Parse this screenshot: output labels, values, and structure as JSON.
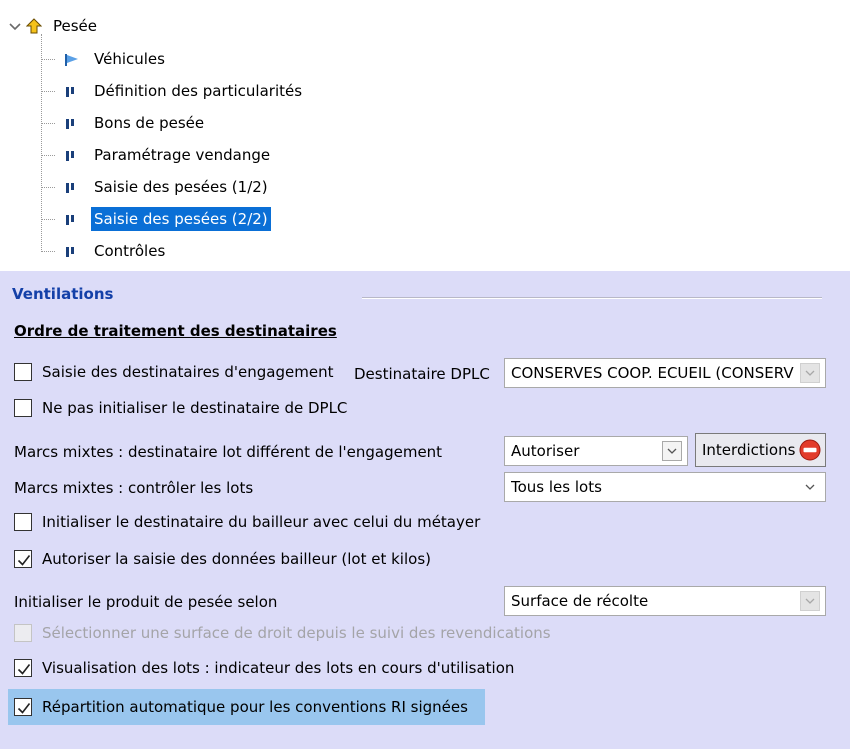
{
  "tree": {
    "root_label": "Pesée",
    "items": [
      {
        "label": "Véhicules",
        "icon": "flag-icon"
      },
      {
        "label": "Définition des particularités",
        "icon": "bar-icon"
      },
      {
        "label": "Bons de pesée",
        "icon": "bar-icon"
      },
      {
        "label": "Paramétrage vendange",
        "icon": "bar-icon"
      },
      {
        "label": "Saisie des pesées (1/2)",
        "icon": "bar-icon"
      },
      {
        "label": "Saisie des pesées (2/2)",
        "icon": "bar-icon",
        "selected": true
      },
      {
        "label": "Contrôles",
        "icon": "bar-icon"
      }
    ]
  },
  "panel": {
    "section_title": "Ventilations",
    "subsection_title": "Ordre de traitement des destinataires",
    "saisie_destinataires": {
      "label": "Saisie des destinataires d'engagement",
      "checked": false
    },
    "destinataire_dplc": {
      "label": "Destinataire DPLC",
      "value": "CONSERVES COOP. ECUEIL (CONSERV"
    },
    "ne_pas_initialiser": {
      "label": "Ne pas initialiser le destinataire de DPLC",
      "checked": false
    },
    "marcs_mixtes_dest": {
      "label": "Marcs mixtes : destinataire lot différent de l'engagement",
      "value": "Autoriser"
    },
    "interdictions_button": "Interdictions",
    "marcs_mixtes_lots": {
      "label": "Marcs mixtes : contrôler les lots",
      "value": "Tous les lots"
    },
    "initialiser_bailleur": {
      "label": "Initialiser le destinataire du bailleur avec celui du métayer",
      "checked": false
    },
    "autoriser_saisie_bailleur": {
      "label": "Autoriser la saisie des données bailleur (lot et kilos)",
      "checked": true
    },
    "initialiser_produit": {
      "label": "Initialiser le produit de pesée selon",
      "value": "Surface de récolte"
    },
    "selectionner_surface": {
      "label": "Sélectionner une surface de droit depuis le suivi des revendications",
      "checked": false,
      "disabled": true
    },
    "visualisation_lots": {
      "label": "Visualisation des lots : indicateur des lots en cours d'utilisation",
      "checked": true
    },
    "repartition_auto": {
      "label": "Répartition automatique pour les conventions RI signées",
      "checked": true
    }
  },
  "colors": {
    "panel_bg": "#dcdcf8",
    "section_title": "#1440a8",
    "selection": "#0a6fd6",
    "focus_highlight": "#99c6ee"
  }
}
